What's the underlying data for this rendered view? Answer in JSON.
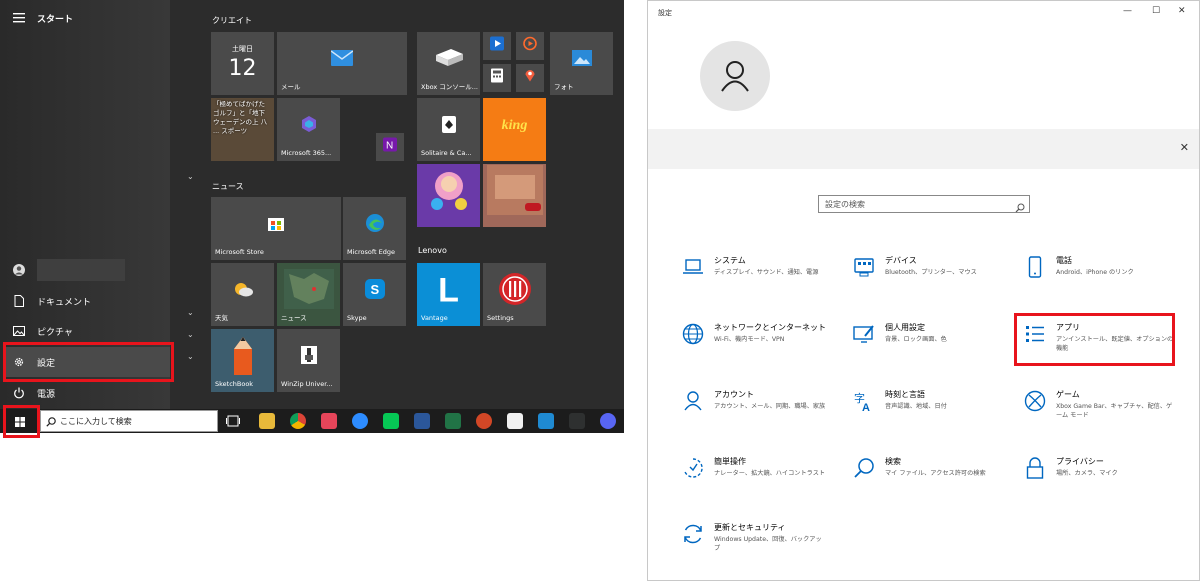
{
  "start": {
    "title": "スタート",
    "user_name": "",
    "nav": {
      "documents": "ドキュメント",
      "pictures": "ピクチャ",
      "settings": "設定",
      "power": "電源"
    },
    "groups": {
      "create": "クリエイト",
      "news": "ニュース",
      "lenovo": "Lenovo"
    },
    "tiles": {
      "calendar_day": "土曜日",
      "calendar_date": "12",
      "mail": "メール",
      "xbox": "Xbox コンソール...",
      "photos": "フォト",
      "news_tile": "「極めてばかげた ゴルフ」と「地下 ウェーデンの上 八 ... スポーツ",
      "m365": "Microsoft 365...",
      "solitaire": "Solitaire & Ca...",
      "store": "Microsoft Store",
      "edge": "Microsoft Edge",
      "weather": "天気",
      "news2": "ニュース",
      "skype": "Skype",
      "vantage": "Vantage",
      "settings_tile": "Settings",
      "sketchbook": "SketchBook",
      "winzip": "WinZip Univer..."
    }
  },
  "taskbar": {
    "search_placeholder": "ここに入力して検索"
  },
  "settings": {
    "window_title": "設定",
    "search_placeholder": "設定の検索",
    "categories": [
      {
        "title": "システム",
        "desc": "ディスプレイ、サウンド、通知、電源",
        "icon": "laptop-icon"
      },
      {
        "title": "デバイス",
        "desc": "Bluetooth、プリンター、マウス",
        "icon": "devices-icon"
      },
      {
        "title": "電話",
        "desc": "Android、iPhone のリンク",
        "icon": "phone-icon"
      },
      {
        "title": "ネットワークとインターネット",
        "desc": "Wi-Fi、機内モード、VPN",
        "icon": "globe-icon"
      },
      {
        "title": "個人用設定",
        "desc": "背景、ロック画面、色",
        "icon": "personalization-icon"
      },
      {
        "title": "アプリ",
        "desc": "アンインストール、既定値、オプションの機能",
        "icon": "apps-list-icon"
      },
      {
        "title": "アカウント",
        "desc": "アカウント、メール、同期、職場、家族",
        "icon": "person-icon"
      },
      {
        "title": "時刻と言語",
        "desc": "音声認識、地域、日付",
        "icon": "time-language-icon"
      },
      {
        "title": "ゲーム",
        "desc": "Xbox Game Bar、キャプチャ、配信、ゲーム モード",
        "icon": "xbox-icon"
      },
      {
        "title": "簡単操作",
        "desc": "ナレーター、拡大鏡、ハイコントラスト",
        "icon": "ease-of-access-icon"
      },
      {
        "title": "検索",
        "desc": "マイ ファイル、アクセス許可の検索",
        "icon": "search-icon"
      },
      {
        "title": "プライバシー",
        "desc": "場所、カメラ、マイク",
        "icon": "lock-icon"
      },
      {
        "title": "更新とセキュリティ",
        "desc": "Windows Update、回復、バックアップ",
        "icon": "update-icon"
      }
    ]
  },
  "colors": {
    "highlight_red": "#e8141c",
    "settings_blue": "#0067c0",
    "start_bg": "#2c2c2c"
  }
}
